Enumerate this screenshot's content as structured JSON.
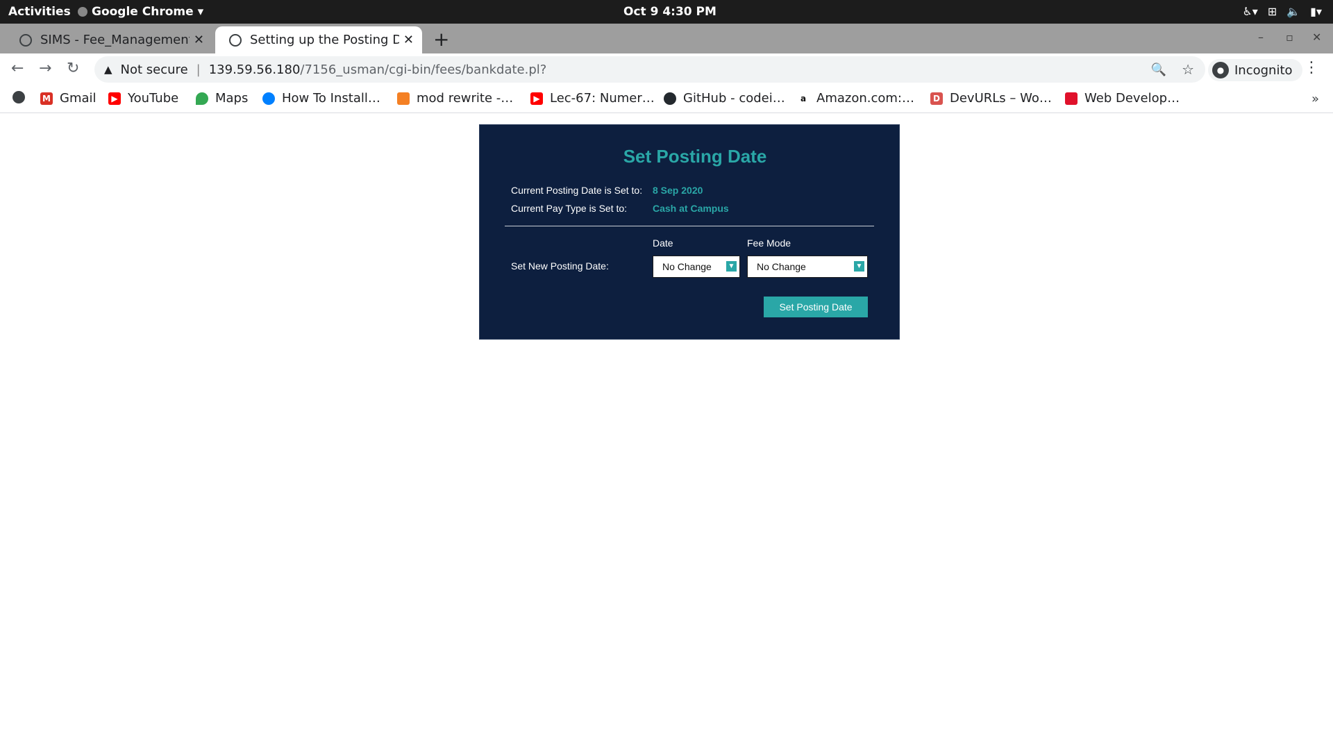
{
  "system": {
    "activities": "Activities",
    "app_name": "Google Chrome",
    "clock": "Oct 9   4:30 PM"
  },
  "browser": {
    "tabs": [
      {
        "label": "SIMS - Fee_Management",
        "active": false
      },
      {
        "label": "Setting up the Posting Da",
        "active": true
      }
    ],
    "address": {
      "security_label": "Not secure",
      "host": "139.59.56.180",
      "path": "/7156_usman/cgi-bin/fees/bankdate.pl?"
    },
    "profile_label": "Incognito",
    "bookmarks": [
      {
        "label": "Gmail",
        "icon": "gmail-icon"
      },
      {
        "label": "YouTube",
        "icon": "youtube-icon"
      },
      {
        "label": "Maps",
        "icon": "maps-icon"
      },
      {
        "label": "How To Install…",
        "icon": "digitalocean-icon"
      },
      {
        "label": "mod rewrite -…",
        "icon": "stackoverflow-icon"
      },
      {
        "label": "Lec-67: Numer…",
        "icon": "youtube-icon"
      },
      {
        "label": "GitHub - codei…",
        "icon": "github-icon"
      },
      {
        "label": "Amazon.com:…",
        "icon": "amazon-icon"
      },
      {
        "label": "DevURLs – Wo…",
        "icon": "devurls-icon"
      },
      {
        "label": "Web Develop…",
        "icon": "bookmark-red-icon"
      }
    ]
  },
  "page": {
    "title": "Set Posting Date",
    "current_date_label": "Current Posting Date is Set to:",
    "current_date_value": "8 Sep 2020",
    "current_paytype_label": "Current Pay Type is Set to:",
    "current_paytype_value": "Cash at Campus",
    "date_column": "Date",
    "feemode_column": "Fee Mode",
    "new_date_label": "Set New Posting Date:",
    "date_select_value": "No Change",
    "feemode_select_value": "No Change",
    "submit_label": "Set Posting Date"
  },
  "colors": {
    "panel_bg": "#0d1f3f",
    "accent": "#2aa7a7"
  }
}
